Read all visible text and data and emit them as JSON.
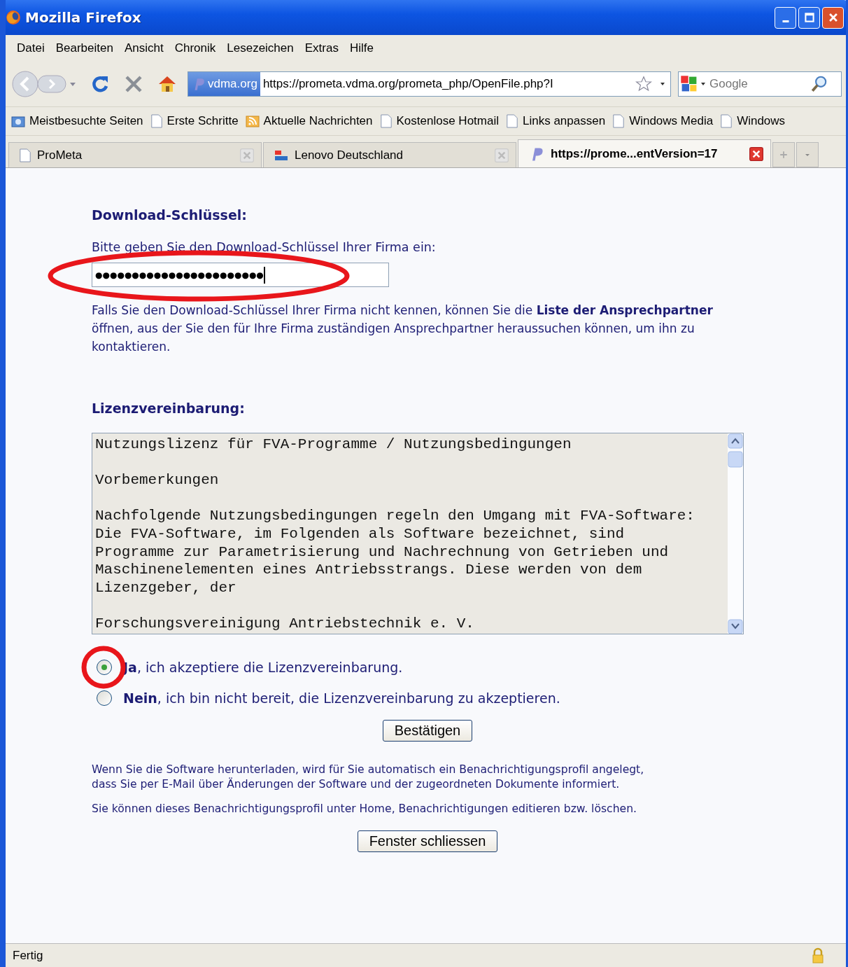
{
  "window": {
    "title": "Mozilla Firefox"
  },
  "menu_bar": [
    "Datei",
    "Bearbeiten",
    "Ansicht",
    "Chronik",
    "Lesezeichen",
    "Extras",
    "Hilfe"
  ],
  "navigation": {
    "site_identity": "vdma.org",
    "url": "https://prometa.vdma.org/prometa_php/OpenFile.php?I",
    "search_placeholder": "Google"
  },
  "bookmarks": [
    {
      "label": "Meistbesuchte Seiten",
      "kind": "smart"
    },
    {
      "label": "Erste Schritte",
      "kind": "page"
    },
    {
      "label": "Aktuelle Nachrichten",
      "kind": "feed"
    },
    {
      "label": "Kostenlose Hotmail",
      "kind": "page"
    },
    {
      "label": "Links anpassen",
      "kind": "page"
    },
    {
      "label": "Windows Media",
      "kind": "page"
    },
    {
      "label": "Windows",
      "kind": "page"
    }
  ],
  "tabs": [
    {
      "label": "ProMeta",
      "kind": "page",
      "selected": false
    },
    {
      "label": "Lenovo Deutschland",
      "kind": "lenovo",
      "selected": false
    },
    {
      "label": "https://prome...entVersion=17",
      "kind": "prometa",
      "selected": true
    }
  ],
  "page": {
    "key_section": {
      "heading": "Download-Schlüssel:",
      "prompt": "Bitte geben Sie den Download-Schlüssel Ihrer Firma ein:",
      "value": "●●●●●●●●●●●●●●●●●●●●●●●",
      "help": "Falls Sie den Download-Schlüssel Ihrer Firma nicht kennen, können Sie die **Liste der Ansprechpartner** öffnen, aus der Sie den für Ihre Firma zuständigen Ansprechpartner heraussuchen können, um ihn zu kontaktieren."
    },
    "license": {
      "heading": "Lizenzvereinbarung:",
      "paragraphs": [
        "Nutzungslizenz für FVA-Programme / Nutzungsbedingungen",
        "Vorbemerkungen",
        "Nachfolgende Nutzungsbedingungen regeln den Umgang mit FVA-Software:\nDie FVA-Software, im Folgenden als Software bezeichnet, sind\nProgramme zur Parametrisierung und Nachrechnung von Getrieben und\nMaschinenelementen eines Antriebsstrangs. Diese werden von dem\nLizenzgeber, der",
        "Forschungsvereinigung Antriebstechnik e. V."
      ]
    },
    "options": [
      {
        "label": "**Ja**, ich akzeptiere die Lizenzvereinbarung.",
        "selected": true
      },
      {
        "label": "**Nein**, ich bin nicht bereit, die Lizenzvereinbarung zu akzeptieren.",
        "selected": false
      }
    ],
    "confirm_button": "Bestätigen",
    "notices": [
      "Wenn Sie die Software herunterladen, wird für Sie automatisch ein Benachrichtigungsprofil angelegt,\ndass Sie per E-Mail über Änderungen der Software und der zugeordneten Dokumente informiert.",
      "Sie können dieses Benachrichtigungsprofil unter Home, Benachrichtigungen editieren bzw. löschen."
    ],
    "close_button": "Fenster schliessen"
  },
  "status_bar": {
    "text": "Fertig"
  }
}
